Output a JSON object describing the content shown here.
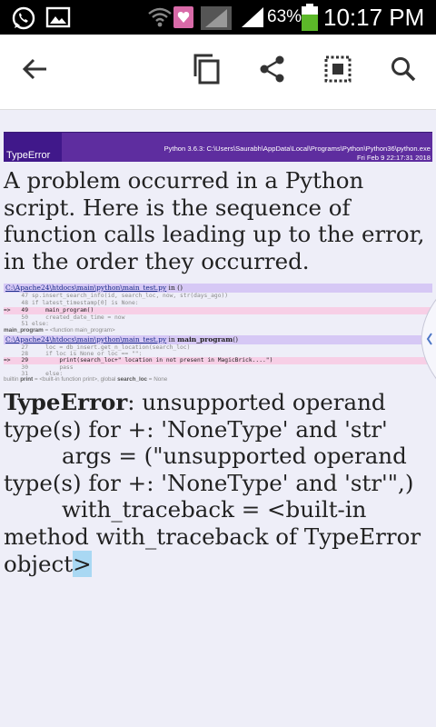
{
  "status_bar": {
    "battery_percent": "63%",
    "time": "10:17 PM",
    "icons": [
      "whatsapp-icon",
      "gallery-icon",
      "wifi-icon",
      "heart-notification-icon",
      "mobile-data-icon",
      "signal-icon",
      "battery-icon"
    ]
  },
  "toolbar": {
    "icons": [
      "back-arrow-icon",
      "copy-icon",
      "share-icon",
      "select-all-icon",
      "search-icon"
    ]
  },
  "header": {
    "error_type": "TypeError",
    "python_info": "Python 3.6.3: C:\\Users\\Saurabh\\AppData\\Local\\Programs\\Python\\Python36\\python.exe",
    "date": "Fri Feb 9 22:17:31 2018"
  },
  "intro_text": "A problem occurred in a Python script. Here is the sequence of function calls leading up to the error, in the order they occurred.",
  "frame1": {
    "path": "C:\\Apache24\\htdocs\\main\\python\\main_test.py",
    "suffix": " in ()",
    "lines": [
      {
        "arrow": "",
        "num": "47",
        "code": "sp.insert_search_info(id, search_loc, now, str(days_ago))"
      },
      {
        "arrow": "",
        "num": "48",
        "code": "if latest_timestamp[0] is None:"
      },
      {
        "arrow": "=>",
        "num": "49",
        "code": "    main_program()"
      },
      {
        "arrow": "",
        "num": "50",
        "code": "    created_date_time = now"
      },
      {
        "arrow": "",
        "num": "51",
        "code": "else:"
      }
    ],
    "note_name": "main_program",
    "note_rest": " = <function main_program>"
  },
  "frame2": {
    "path": "C:\\Apache24\\htdocs\\main\\python\\main_test.py",
    "suffix_in": " in ",
    "func": "main_program",
    "suffix_end": "()",
    "lines": [
      {
        "arrow": "",
        "num": "27",
        "code": "    loc = db_insert.get_n_location(search_loc)"
      },
      {
        "arrow": "",
        "num": "28",
        "code": "    if loc is None or loc == \"\":"
      },
      {
        "arrow": "=>",
        "num": "29",
        "code": "        print(search_loc+\" location in not present in MagicBrick....\")"
      },
      {
        "arrow": "",
        "num": "30",
        "code": "        pass"
      },
      {
        "arrow": "",
        "num": "31",
        "code": "    else:"
      }
    ],
    "note_pre": "builtin ",
    "note_print": "print",
    "note_mid": " = <built-in function print>, global ",
    "note_loc": "search_loc",
    "note_end": " = None"
  },
  "error": {
    "type": "TypeError",
    "message": ": unsupported operand type(s) for +: 'NoneType' and 'str'",
    "args_line": "args = (\"unsupported operand type(s) for +: 'NoneType' and 'str'\",)",
    "traceback_line": "with_traceback = <built-in method with_traceback of TypeError object",
    "cursor_char": ">"
  }
}
